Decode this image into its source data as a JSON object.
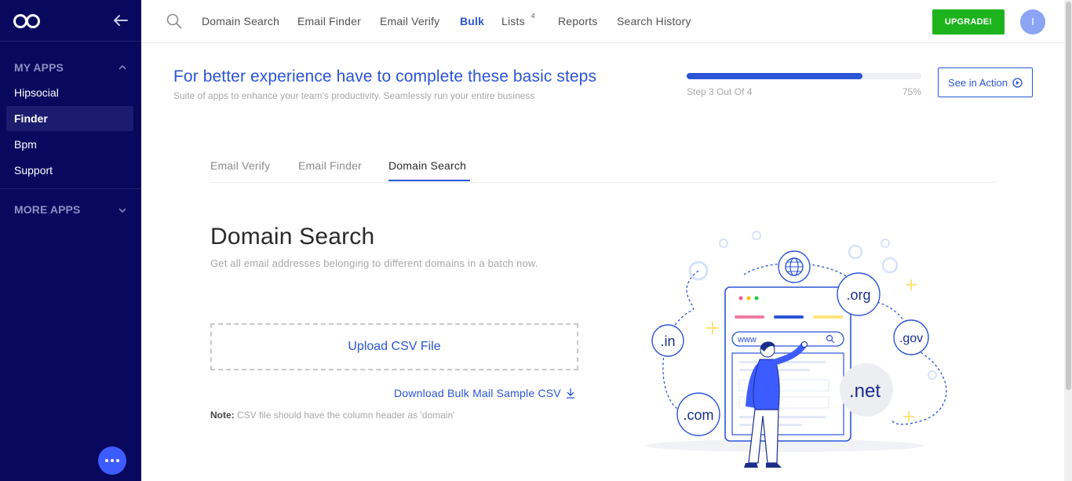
{
  "sidebar": {
    "sections": [
      {
        "label": "MY APPS",
        "expanded": true
      },
      {
        "label": "MORE APPS",
        "expanded": false
      }
    ],
    "items": [
      {
        "label": "Hipsocial"
      },
      {
        "label": "Finder",
        "active": true
      },
      {
        "label": "Bpm"
      },
      {
        "label": "Support"
      }
    ]
  },
  "topnav": {
    "items": [
      {
        "label": "Domain Search"
      },
      {
        "label": "Email Finder"
      },
      {
        "label": "Email Verify"
      },
      {
        "label": "Bulk",
        "active": true
      },
      {
        "label": "Lists",
        "badge": "4"
      },
      {
        "label": "Reports"
      },
      {
        "label": "Search History"
      }
    ],
    "upgrade_label": "UPGRADE!",
    "avatar_initial": "I"
  },
  "banner": {
    "title": "For better experience have to complete these basic steps",
    "subtitle": "Suite of apps to enhance your team's productivity. Seamlessly run your entire business",
    "progress_fraction": 0.75,
    "step_text": "Step 3 Out Of 4",
    "percent_text": "75%",
    "see_action_label": "See in Action"
  },
  "tabs": [
    {
      "label": "Email Verify"
    },
    {
      "label": "Email Finder"
    },
    {
      "label": "Domain Search",
      "active": true
    }
  ],
  "content": {
    "title": "Domain Search",
    "description": "Get all email addresses belonging to different domains in a batch now.",
    "upload_label": "Upload CSV File",
    "download_label": "Download Bulk Mail Sample CSV",
    "note_label": "Note:",
    "note_text": "CSV file should have the column header as 'domain'"
  },
  "illustration": {
    "search_text": "www",
    "domains": [
      ".org",
      ".in",
      ".gov",
      ".com",
      ".net"
    ]
  },
  "colors": {
    "sidebar_bg": "#08085e",
    "accent": "#2b54d6",
    "upgrade": "#1db31d",
    "fab": "#3d5cff"
  }
}
